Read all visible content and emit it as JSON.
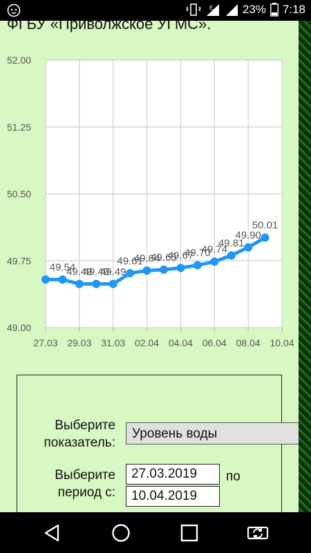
{
  "status_bar": {
    "battery_percent": "23%",
    "time": "7:18",
    "icons": [
      "app-lion-icon",
      "vibrate-icon",
      "signal-e-icon",
      "signal-icon",
      "battery-icon"
    ]
  },
  "page": {
    "org_name": "ФГБУ «Приволжское УГМС»."
  },
  "chart_data": {
    "type": "line",
    "x": [
      "27.03",
      "28.03",
      "29.03",
      "30.03",
      "31.03",
      "01.04",
      "02.04",
      "03.04",
      "04.04",
      "05.04",
      "06.04",
      "07.04",
      "08.04",
      "09.04"
    ],
    "x_tick_labels": [
      "27.03",
      "29.03",
      "31.03",
      "02.04",
      "04.04",
      "06.04",
      "08.04",
      "10.04"
    ],
    "y_tick_labels": [
      "52.00",
      "51.25",
      "50.50",
      "49.75",
      "49.00"
    ],
    "series": [
      {
        "values": [
          49.54,
          49.54,
          49.49,
          49.49,
          49.49,
          49.61,
          49.64,
          49.65,
          49.67,
          49.7,
          49.74,
          49.81,
          49.9,
          50.01
        ],
        "point_labels": [
          "",
          "49.54",
          "49.49",
          "49.49",
          "49.49",
          "49.61",
          "49.64",
          "49.65",
          "49.67",
          "49.70",
          "49.74",
          "49.81",
          "49.90",
          "50.01"
        ],
        "color": "#2196f3"
      }
    ],
    "ylim": [
      49.0,
      52.0
    ],
    "grid": true
  },
  "form": {
    "indicator_label_line1": "Выберите",
    "indicator_label_line2": "показатель:",
    "indicator_value": "Уровень воды",
    "period_label_line1": "Выберите",
    "period_label_line2": "период с:",
    "date_from": "27.03.2019",
    "to_label": "по",
    "date_to": "10.04.2019"
  },
  "nav_bar": {
    "buttons": [
      "back-icon",
      "home-icon",
      "recents-icon",
      "rotate-icon"
    ]
  }
}
